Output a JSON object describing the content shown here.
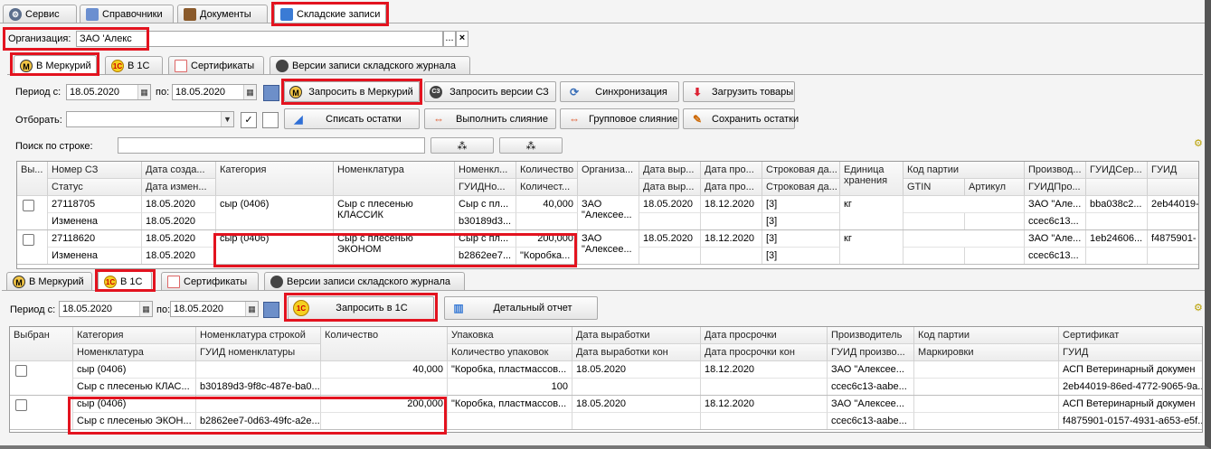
{
  "top_tabs": [
    {
      "label": "Сервис",
      "icon": "gear-icon"
    },
    {
      "label": "Справочники",
      "icon": "catalog-icon"
    },
    {
      "label": "Документы",
      "icon": "briefcase-icon"
    },
    {
      "label": "Складские записи",
      "icon": "warehouse-icon"
    }
  ],
  "org": {
    "label": "Организация:",
    "value": "ЗАО  'Алекс",
    "browse": "...",
    "clear": "×"
  },
  "sub_tabs": [
    {
      "label": "В Меркурий",
      "icon": "M"
    },
    {
      "label": "В 1С",
      "icon": "1С"
    },
    {
      "label": "Сертификаты"
    },
    {
      "label": "Версии записи складского журнала"
    }
  ],
  "filters": {
    "period_from_label": "Период с:",
    "period_from": "18.05.2020",
    "period_to_label": "по:",
    "period_to": "18.05.2020",
    "select_label": "Отборать:",
    "search_label": "Поиск по строке:"
  },
  "buttons_top": [
    {
      "label": "Запросить в Меркурий",
      "icon": "M"
    },
    {
      "label": "Запросить версии СЗ",
      "icon": "СЗ"
    },
    {
      "label": "Синхронизация"
    },
    {
      "label": "Загрузить товары"
    },
    {
      "label": "Списать остатки"
    },
    {
      "label": "Выполнить слияние"
    },
    {
      "label": "Групповое слияние"
    },
    {
      "label": "Сохранить остатки"
    }
  ],
  "grid1": {
    "header_row1": [
      "Вы...",
      "Номер СЗ",
      "Дата созда...",
      "Категория",
      "Номенклатура",
      "Номенкл...",
      "Количество",
      "Организа...",
      "Дата выр...",
      "Дата про...",
      "Строковая да...",
      "Единица хранения",
      "Код партии",
      "",
      "Производ...",
      "ГУИДСер...",
      "ГУИД"
    ],
    "header_row2": [
      "",
      "Статус",
      "Дата измен...",
      "",
      "",
      "ГУИДНо...",
      "Количест...",
      "",
      "Дата выр...",
      "Дата про...",
      "Строковая да...",
      "",
      "GTIN",
      "Артикул",
      "ГУИДПро...",
      "",
      ""
    ],
    "rows": [
      {
        "number": "27118705",
        "status": "Изменена",
        "created": "18.05.2020",
        "changed": "18.05.2020",
        "category": "сыр (0406)",
        "nomenclature": "Сыр с плесенью КЛАССИК",
        "nom_short": "Сыр с пл...",
        "nom_guid": "b30189d3...",
        "qty": "40,000",
        "qty2": "",
        "org": "ЗАО \"Алексее...",
        "date_prod": "18.05.2020",
        "date_exp": "18.12.2020",
        "str1": "[3]",
        "str2": "[3]",
        "unit": "кг",
        "producer": "ЗАО \"Але...",
        "producer_guid": "ccec6c13...",
        "cert_guid": "bba038c2...",
        "guid": "2eb44019-"
      },
      {
        "number": "27118620",
        "status": "Изменена",
        "created": "18.05.2020",
        "changed": "18.05.2020",
        "category": "сыр (0406)",
        "nomenclature": "Сыр с плесенью ЭКОНОМ",
        "nom_short": "Сыр с пл...",
        "nom_guid": "b2862ee7...",
        "qty": "200,000",
        "qty2": "\"Коробка...",
        "org": "ЗАО \"Алексее...",
        "date_prod": "18.05.2020",
        "date_exp": "18.12.2020",
        "str1": "[3]",
        "str2": "[3]",
        "unit": "кг",
        "producer": "ЗАО \"Але...",
        "producer_guid": "ccec6c13...",
        "cert_guid": "1eb24606...",
        "guid": "f4875901-"
      }
    ]
  },
  "lower_tabs": [
    {
      "label": "В Меркурий"
    },
    {
      "label": "В 1С"
    },
    {
      "label": "Сертификаты"
    },
    {
      "label": "Версии записи складского журнала"
    }
  ],
  "lower_filters": {
    "period_from_label": "Период с:",
    "period_from": "18.05.2020",
    "period_to_label": "по:",
    "period_to": "18.05.2020"
  },
  "buttons_bottom": [
    {
      "label": "Запросить в 1С"
    },
    {
      "label": "Детальный отчет"
    }
  ],
  "grid2": {
    "header_row1": [
      "Выбран",
      "Категория",
      "Номенклатура строкой",
      "Количество",
      "Упаковка",
      "Дата выработки",
      "Дата просрочки",
      "Производитель",
      "Код партии",
      "Сертификат"
    ],
    "header_row2": [
      "",
      "Номенклатура",
      "ГУИД номенклатуры",
      "",
      "Количество упаковок",
      "Дата выработки кон",
      "Дата просрочки кон",
      "ГУИД произво...",
      "Маркировки",
      "ГУИД"
    ],
    "rows": [
      {
        "category": "сыр (0406)",
        "nomenclature": "Сыр с плесенью КЛАС...",
        "nom_guid": "b30189d3-9f8c-487e-ba0...",
        "qty": "40,000",
        "package": "\"Коробка, пластмассов...",
        "pkg_count": "100",
        "date_prod": "18.05.2020",
        "date_exp": "18.12.2020",
        "producer": "ЗАО \"Алексее...",
        "producer_guid": "ccec6c13-aabe...",
        "cert": "АСП Ветеринарный докумен",
        "cert_guid": "2eb44019-86ed-4772-9065-9a..."
      },
      {
        "category": "сыр (0406)",
        "nomenclature": "Сыр с плесенью ЭКОН...",
        "nom_guid": "b2862ee7-0d63-49fc-a2e...",
        "qty": "200,000",
        "package": "\"Коробка, пластмассов...",
        "pkg_count": "",
        "date_prod": "18.05.2020",
        "date_exp": "18.12.2020",
        "producer": "ЗАО \"Алексее...",
        "producer_guid": "ccec6c13-aabe...",
        "cert": "АСП Ветеринарный докумен",
        "cert_guid": "f4875901-0157-4931-a653-e5f..."
      }
    ]
  },
  "colors": {
    "highlight": "#e3131f",
    "grid_border": "#9a9a9a",
    "header_bg": "#ececec"
  }
}
